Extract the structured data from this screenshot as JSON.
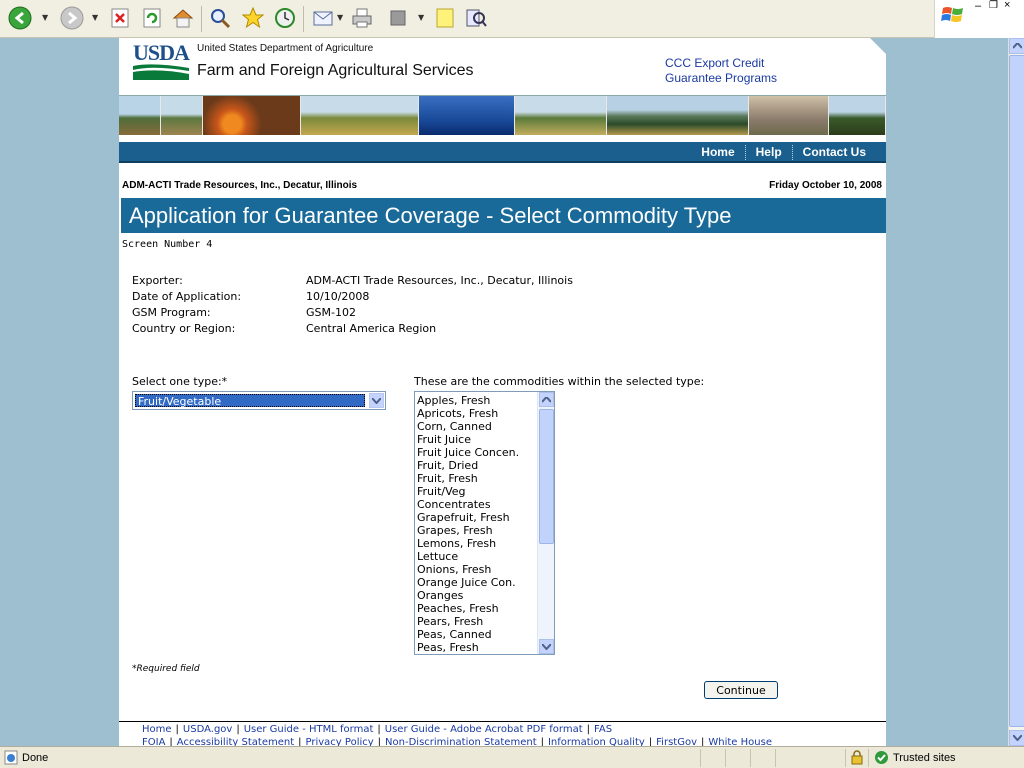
{
  "header": {
    "logo_text": "USDA",
    "department": "United States Department of Agriculture",
    "agency": "Farm and Foreign Agricultural Services",
    "ccc_link": "CCC Export Credit Guarantee Programs"
  },
  "nav": {
    "home": "Home",
    "help": "Help",
    "contact": "Contact Us"
  },
  "context": {
    "organization": "ADM-ACTI Trade Resources, Inc., Decatur, Illinois",
    "date": "Friday October 10, 2008"
  },
  "page_title": "Application for Guarantee Coverage - Select Commodity Type",
  "screen_number": "Screen Number 4",
  "info": {
    "exporter_label": "Exporter:",
    "exporter_value": "ADM-ACTI Trade Resources, Inc., Decatur, Illinois",
    "date_label": "Date of Application:",
    "date_value": "10/10/2008",
    "program_label": "GSM Program:",
    "program_value": "GSM-102",
    "country_label": "Country or Region:",
    "country_value": "Central America Region"
  },
  "form": {
    "type_label": "Select one type:*",
    "type_selected": "Fruit/Vegetable",
    "list_label": "These are the commodities within the selected type:",
    "commodities": [
      "Apples, Fresh",
      "Apricots, Fresh",
      "Corn, Canned",
      "Fruit Juice",
      "Fruit Juice Concen.",
      "Fruit, Dried",
      "Fruit, Fresh",
      "Fruit/Veg",
      "Concentrates",
      "Grapefruit, Fresh",
      "Grapes, Fresh",
      "Lemons, Fresh",
      "Lettuce",
      "Onions, Fresh",
      "Orange Juice Con.",
      "Oranges",
      "Peaches, Fresh",
      "Pears, Fresh",
      "Peas, Canned",
      "Peas, Fresh"
    ],
    "required_note": "*Required field",
    "continue_label": "Continue"
  },
  "footer": {
    "line1": [
      "Home",
      "USDA.gov",
      "User Guide - HTML format",
      "User Guide - Adobe Acrobat PDF format",
      "FAS"
    ],
    "line2": [
      "FOIA",
      "Accessibility Statement",
      "Privacy Policy",
      "Non-Discrimination Statement",
      "Information Quality",
      "FirstGov",
      "White House"
    ]
  },
  "statusbar": {
    "status": "Done",
    "zone": "Trusted sites"
  },
  "colors": {
    "nav_blue": "#1a5f8d",
    "title_blue": "#1a6a99",
    "link_blue": "#1a3aa0",
    "page_bg": "#9ebfd0"
  }
}
